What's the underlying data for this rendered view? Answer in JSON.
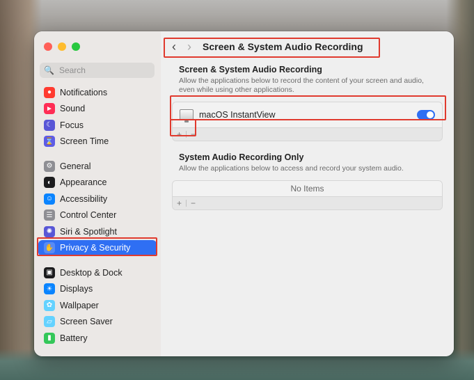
{
  "window": {
    "title": "Screen & System Audio Recording"
  },
  "sidebar": {
    "search_placeholder": "Search",
    "groups": [
      [
        {
          "label": "Notifications",
          "icon": "bell-icon",
          "color": "#ff3b30"
        },
        {
          "label": "Sound",
          "icon": "speaker-icon",
          "color": "#ff2d55"
        },
        {
          "label": "Focus",
          "icon": "moon-icon",
          "color": "#5856d6"
        },
        {
          "label": "Screen Time",
          "icon": "hourglass-icon",
          "color": "#5e5ce6"
        }
      ],
      [
        {
          "label": "General",
          "icon": "gear-icon",
          "color": "#8e8e93"
        },
        {
          "label": "Appearance",
          "icon": "appearance-icon",
          "color": "#1c1c1e"
        },
        {
          "label": "Accessibility",
          "icon": "accessibility-icon",
          "color": "#0a84ff"
        },
        {
          "label": "Control Center",
          "icon": "control-center-icon",
          "color": "#8e8e93"
        },
        {
          "label": "Siri & Spotlight",
          "icon": "siri-icon",
          "color": "#5856d6"
        },
        {
          "label": "Privacy & Security",
          "icon": "hand-icon",
          "color": "#0a84ff",
          "active": true
        }
      ],
      [
        {
          "label": "Desktop & Dock",
          "icon": "dock-icon",
          "color": "#1c1c1e"
        },
        {
          "label": "Displays",
          "icon": "sun-icon",
          "color": "#0a84ff"
        },
        {
          "label": "Wallpaper",
          "icon": "flower-icon",
          "color": "#64d2ff"
        },
        {
          "label": "Screen Saver",
          "icon": "screensaver-icon",
          "color": "#64d2ff"
        },
        {
          "label": "Battery",
          "icon": "battery-icon",
          "color": "#34c759"
        }
      ]
    ]
  },
  "main": {
    "section1": {
      "title": "Screen & System Audio Recording",
      "description": "Allow the applications below to record the content of your screen and audio, even while using other applications.",
      "apps": [
        {
          "name": "macOS InstantView",
          "enabled": true
        }
      ]
    },
    "section2": {
      "title": "System Audio Recording Only",
      "description": "Allow the applications below to access and record your system audio.",
      "empty_text": "No Items"
    },
    "controls": {
      "add": "+",
      "remove": "−"
    }
  },
  "colors": {
    "accent": "#2f6ff3",
    "highlight": "#e03a2e"
  }
}
